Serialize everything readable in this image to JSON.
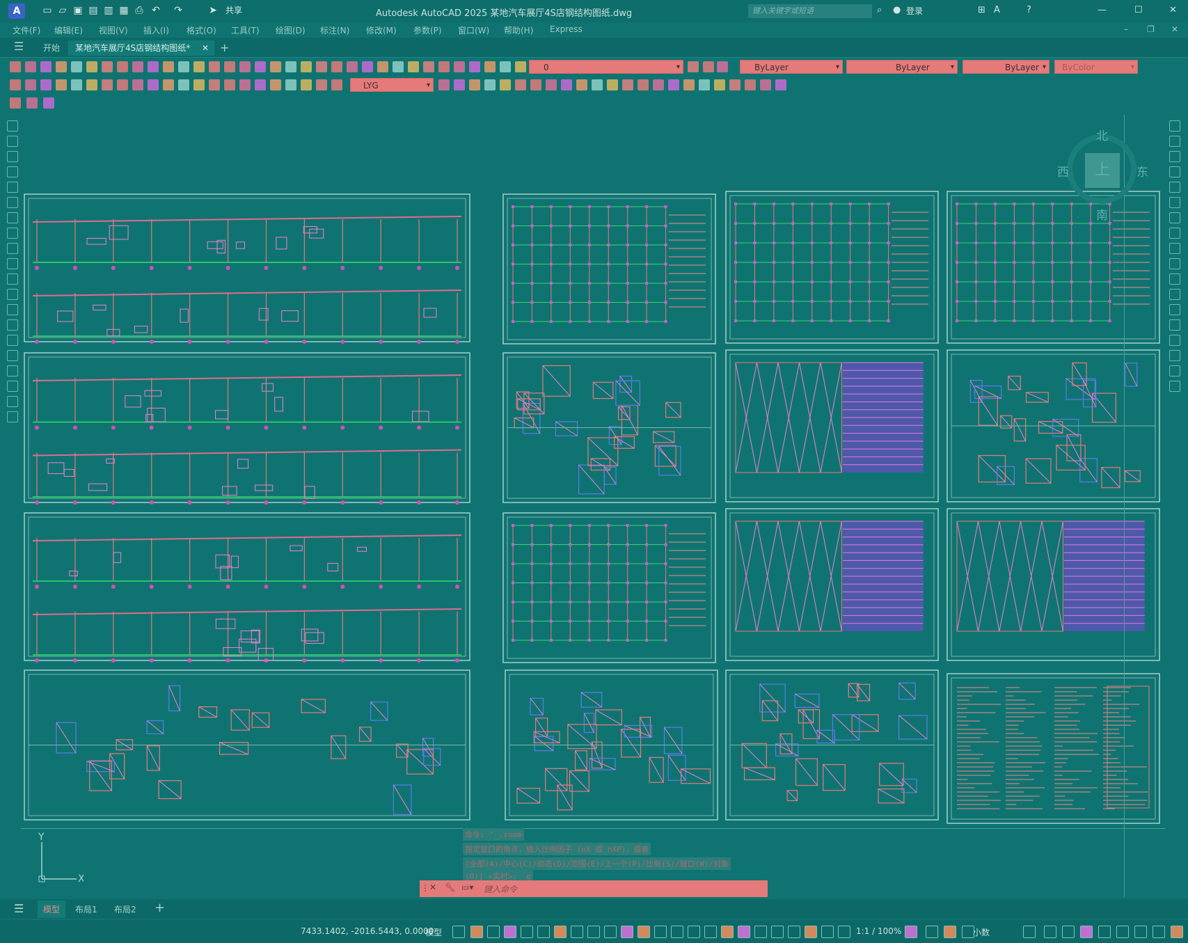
{
  "titlebar": {
    "app_letter": "A",
    "share_label": "共享",
    "title": "Autodesk AutoCAD 2025    某地汽车展厅4S店钢结构图纸.dwg",
    "search_placeholder": "键入关键字或短语",
    "login_label": "登录"
  },
  "menu": [
    "文件(F)",
    "编辑(E)",
    "视图(V)",
    "插入(I)",
    "格式(O)",
    "工具(T)",
    "绘图(D)",
    "标注(N)",
    "修改(M)",
    "参数(P)",
    "窗口(W)",
    "帮助(H)",
    "Express"
  ],
  "tabs": {
    "start": "开始",
    "document": "某地汽车展厅4S店钢结构图纸*"
  },
  "properties": {
    "layer": "0",
    "color": "ByLayer",
    "linetype": "ByLayer",
    "lineweight": "ByLayer",
    "plotstyle": "ByColor",
    "textstyle": "LYG"
  },
  "viewcube": {
    "north": "北",
    "south": "南",
    "west": "西",
    "east": "东",
    "top": "上"
  },
  "ucs": {
    "y": "Y",
    "x": "X"
  },
  "command": {
    "history": [
      "命令: '_.zoom",
      "指定窗口的角点，输入比例因子 (nX 或 nXP)，或者",
      "[全部(A)/中心(C)/动态(D)/范围(E)/上一个(P)/比例(S)/窗口(W)/对象",
      "(O)] <实时>: _e"
    ],
    "placeholder": "键入命令"
  },
  "layouts": [
    "模型",
    "布局1",
    "布局2"
  ],
  "status": {
    "coords": "7433.1402, -2016.5443, 0.0000",
    "space": "模型",
    "scale": "1:1 / 100%",
    "units": "小数"
  },
  "colors": {
    "background": "#0f7471",
    "dropdown": "#e57a7a",
    "sheet_border": "#8fbfba"
  }
}
